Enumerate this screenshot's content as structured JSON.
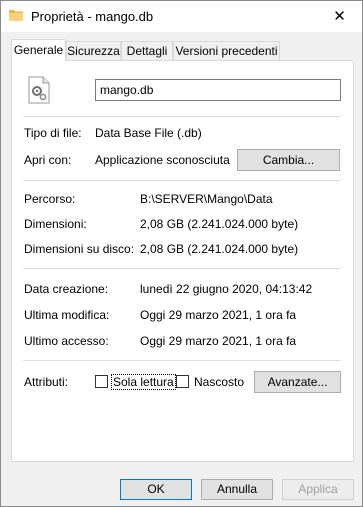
{
  "window": {
    "title": "Proprietà - mango.db",
    "close_glyph": "✕"
  },
  "tabs": [
    {
      "label": "Generale",
      "active": true
    },
    {
      "label": "Sicurezza",
      "active": false
    },
    {
      "label": "Dettagli",
      "active": false
    },
    {
      "label": "Versioni precedenti",
      "active": false
    }
  ],
  "file": {
    "name": "mango.db",
    "icon": "gear-file-icon"
  },
  "type_section": {
    "type_label": "Tipo di file:",
    "type_value": "Data Base File (.db)",
    "open_label": "Apri con:",
    "open_value": "Applicazione sconosciuta",
    "change_button": "Cambia..."
  },
  "location_section": {
    "path_label": "Percorso:",
    "path_value": "B:\\SERVER\\Mango\\Data",
    "size_label": "Dimensioni:",
    "size_value": "2,08 GB (2.241.024.000 byte)",
    "disk_size_label": "Dimensioni su disco:",
    "disk_size_value": "2,08 GB (2.241.024.000 byte)"
  },
  "dates_section": {
    "created_label": "Data creazione:",
    "created_value": "lunedì 22 giugno 2020, 04:13:42",
    "modified_label": "Ultima modifica:",
    "modified_value": "Oggi 29 marzo 2021, 1 ora fa",
    "accessed_label": "Ultimo accesso:",
    "accessed_value": "Oggi 29 marzo 2021, 1 ora fa"
  },
  "attributes": {
    "label": "Attributi:",
    "readonly_label": "Sola lettura",
    "readonly_checked": false,
    "hidden_label": "Nascosto",
    "hidden_checked": false,
    "advanced_button": "Avanzate..."
  },
  "footer": {
    "ok": "OK",
    "cancel": "Annulla",
    "apply": "Applica"
  }
}
